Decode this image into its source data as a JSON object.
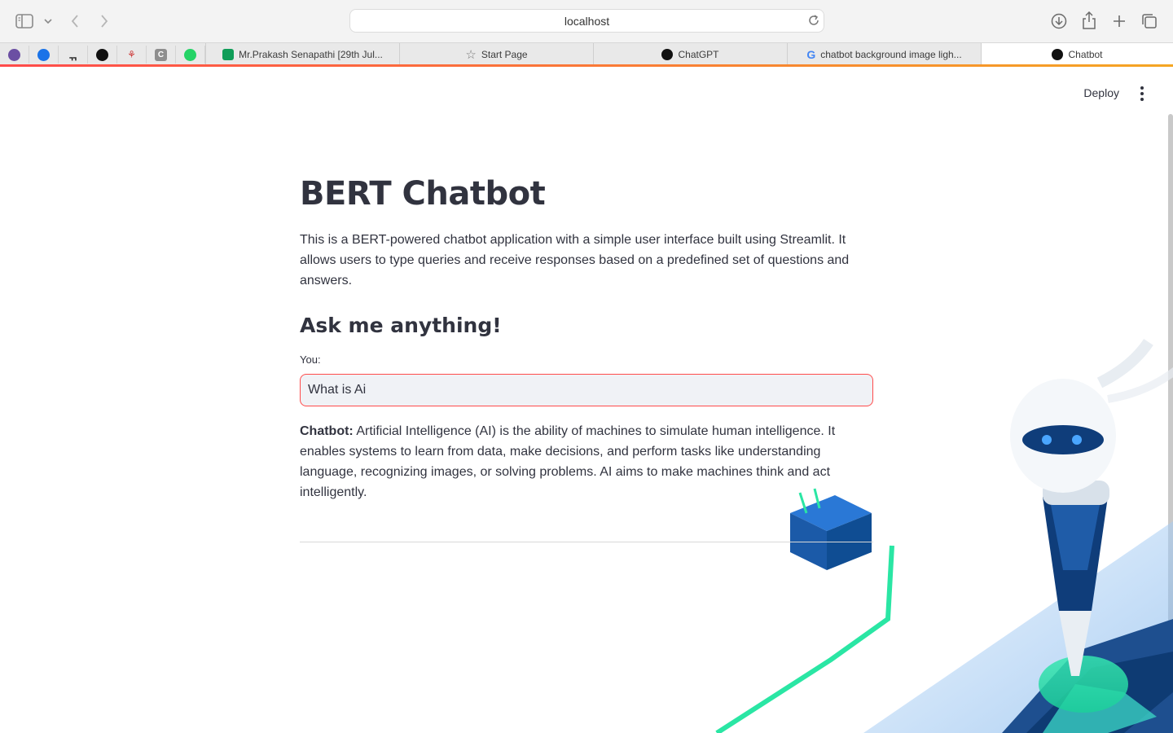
{
  "browser": {
    "url": "localhost",
    "pinned_tabs": [
      {
        "name": "pinned-tab-1",
        "color": "#6b4fa3"
      },
      {
        "name": "pinned-tab-2",
        "color": "#1a73e8"
      },
      {
        "name": "pinned-tab-3",
        "color": "#222222"
      },
      {
        "name": "pinned-tab-github",
        "color": "#111111"
      },
      {
        "name": "pinned-tab-5",
        "color": "#d44"
      },
      {
        "name": "pinned-tab-6",
        "color": "#888888"
      },
      {
        "name": "pinned-tab-whatsapp",
        "color": "#25d366"
      }
    ],
    "tabs": [
      {
        "label": "Mr.Prakash Senapathi [29th Jul...",
        "fav_color": "#0f9d58",
        "icon": "classroom-icon"
      },
      {
        "label": "Start Page",
        "fav_color": "#777777",
        "icon": "star-icon"
      },
      {
        "label": "ChatGPT",
        "fav_color": "#111111",
        "icon": "openai-icon"
      },
      {
        "label": "chatbot background image ligh...",
        "fav_color": "#4285f4",
        "icon": "google-icon"
      },
      {
        "label": "Chatbot",
        "fav_color": "#111111",
        "icon": "streamlit-icon"
      }
    ]
  },
  "header": {
    "deploy_label": "Deploy"
  },
  "main": {
    "title": "BERT Chatbot",
    "intro": "This is a BERT-powered chatbot application with a simple user interface built using Streamlit. It allows users to type queries and receive responses based on a predefined set of questions and answers.",
    "subheading": "Ask me anything!",
    "input_label": "You:",
    "input_value": "What is Ai",
    "response_label": "Chatbot:",
    "response_text": " Artificial Intelligence (AI) is the ability of machines to simulate human intelligence. It enables systems to learn from data, make decisions, and perform tasks like understanding language, recognizing images, or solving problems. AI aims to make machines think and act intelligently."
  },
  "colors": {
    "accent": "#ff4b4b",
    "text": "#31333f",
    "input_bg": "#f0f2f6"
  }
}
